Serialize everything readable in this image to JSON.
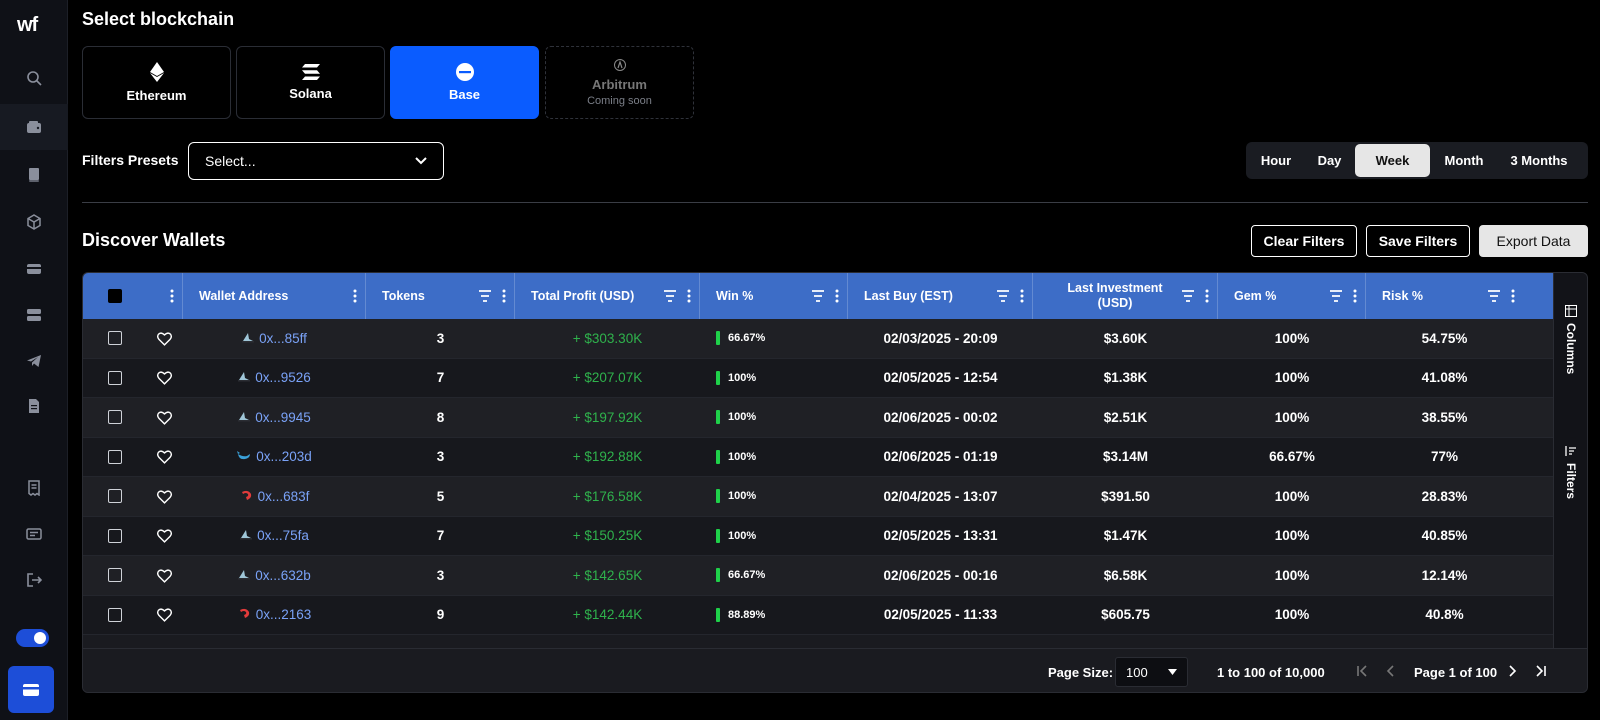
{
  "sidebar": {
    "logo": "wf",
    "icons": [
      "search-icon",
      "wallet-icon",
      "book-icon",
      "cube-icon",
      "card-icon",
      "server-icon",
      "telegram-icon",
      "document-icon",
      "receipt-icon",
      "id-card-icon",
      "logout-icon"
    ],
    "toggle_on": true,
    "accent": "#1d4ed8"
  },
  "header": {
    "select_title": "Select blockchain"
  },
  "chains": [
    {
      "name": "Ethereum",
      "icon": "ethereum-icon",
      "state": "default"
    },
    {
      "name": "Solana",
      "icon": "solana-icon",
      "state": "default"
    },
    {
      "name": "Base",
      "icon": "base-icon",
      "state": "active"
    },
    {
      "name": "Arbitrum",
      "icon": "arbitrum-icon",
      "state": "disabled",
      "sub": "Coming soon"
    }
  ],
  "filters": {
    "label": "Filters Presets",
    "preset_value": "Select..."
  },
  "timeframe": {
    "options": [
      "Hour",
      "Day",
      "Week",
      "Month",
      "3 Months"
    ],
    "selected": "Week"
  },
  "discover": {
    "title": "Discover Wallets",
    "clear_label": "Clear Filters",
    "save_label": "Save Filters",
    "export_label": "Export Data"
  },
  "table": {
    "columns": {
      "wallet": "Wallet Address",
      "tokens": "Tokens",
      "profit": "Total Profit (USD)",
      "win": "Win %",
      "last_buy": "Last Buy (EST)",
      "last_inv": "Last Investment (USD)",
      "gem": "Gem %",
      "risk": "Risk %"
    },
    "side_tabs": {
      "columns": "Columns",
      "filters": "Filters"
    },
    "rows": [
      {
        "addr": "0x...85ff",
        "avatar": "shark",
        "tokens": "3",
        "profit": "+ $303.30K",
        "win": "66.67%",
        "last_buy": "02/03/2025 - 20:09",
        "last_inv": "$3.60K",
        "gem": "100%",
        "risk": "54.75%"
      },
      {
        "addr": "0x...9526",
        "avatar": "shark",
        "tokens": "7",
        "profit": "+ $207.07K",
        "win": "100%",
        "last_buy": "02/05/2025 - 12:54",
        "last_inv": "$1.38K",
        "gem": "100%",
        "risk": "41.08%"
      },
      {
        "addr": "0x...9945",
        "avatar": "shark",
        "tokens": "8",
        "profit": "+ $197.92K",
        "win": "100%",
        "last_buy": "02/06/2025 - 00:02",
        "last_inv": "$2.51K",
        "gem": "100%",
        "risk": "38.55%"
      },
      {
        "addr": "0x...203d",
        "avatar": "whale",
        "tokens": "3",
        "profit": "+ $192.88K",
        "win": "100%",
        "last_buy": "02/06/2025 - 01:19",
        "last_inv": "$3.14M",
        "gem": "66.67%",
        "risk": "77%"
      },
      {
        "addr": "0x...683f",
        "avatar": "shrimp",
        "tokens": "5",
        "profit": "+ $176.58K",
        "win": "100%",
        "last_buy": "02/04/2025 - 13:07",
        "last_inv": "$391.50",
        "gem": "100%",
        "risk": "28.83%"
      },
      {
        "addr": "0x...75fa",
        "avatar": "shark",
        "tokens": "7",
        "profit": "+ $150.25K",
        "win": "100%",
        "last_buy": "02/05/2025 - 13:31",
        "last_inv": "$1.47K",
        "gem": "100%",
        "risk": "40.85%"
      },
      {
        "addr": "0x...632b",
        "avatar": "shark",
        "tokens": "3",
        "profit": "+ $142.65K",
        "win": "66.67%",
        "last_buy": "02/06/2025 - 00:16",
        "last_inv": "$6.58K",
        "gem": "100%",
        "risk": "12.14%"
      },
      {
        "addr": "0x...2163",
        "avatar": "shrimp",
        "tokens": "9",
        "profit": "+ $142.44K",
        "win": "88.89%",
        "last_buy": "02/05/2025 - 11:33",
        "last_inv": "$605.75",
        "gem": "100%",
        "risk": "40.8%"
      }
    ]
  },
  "pagination": {
    "page_size_label": "Page Size:",
    "page_size": "100",
    "range": "1 to 100 of 10,000",
    "page": "Page 1 of 100"
  },
  "colors": {
    "header_blue": "#3d6dc7",
    "profit_green": "#2fb24c",
    "link_blue": "#7aa2f7",
    "base_blue": "#0a5cff"
  }
}
